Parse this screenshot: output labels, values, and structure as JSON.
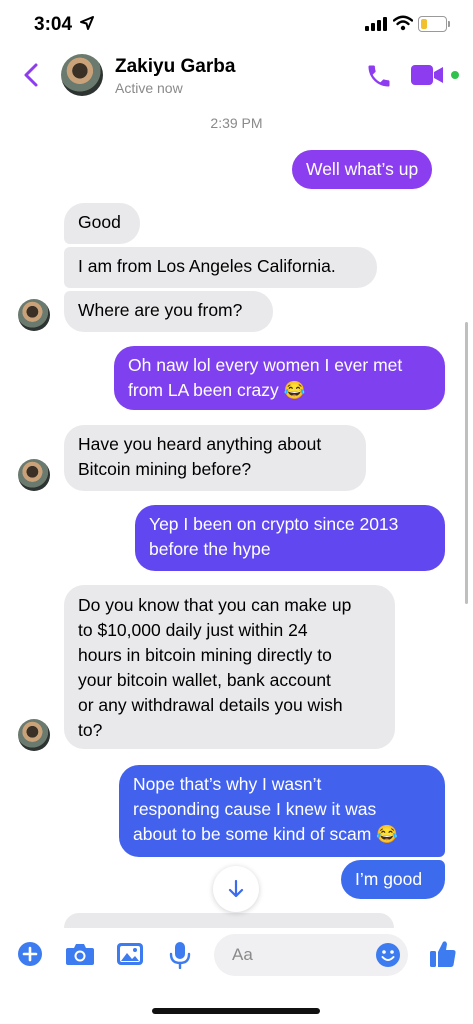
{
  "status_bar": {
    "time": "3:04"
  },
  "header": {
    "contact_name": "Zakiyu Garba",
    "status": "Active now"
  },
  "timestamp": "2:39 PM",
  "messages": [
    {
      "dir": "out",
      "lines": [
        "Well what’s up"
      ]
    },
    {
      "dir": "in",
      "lines": [
        "Good"
      ]
    },
    {
      "dir": "in",
      "lines": [
        "I am from Los Angeles California."
      ]
    },
    {
      "dir": "in",
      "lines": [
        "Where are you from?"
      ]
    },
    {
      "dir": "out",
      "lines": [
        "Oh naw lol every women I ever met",
        "from LA been crazy 😂"
      ]
    },
    {
      "dir": "in",
      "lines": [
        "Have you heard anything about",
        "Bitcoin mining before?"
      ]
    },
    {
      "dir": "out",
      "lines": [
        "Yep I been on crypto since 2013",
        "before the hype"
      ]
    },
    {
      "dir": "in",
      "lines": [
        "Do you know that you can make up",
        "to $10,000 daily just within 24",
        "hours in bitcoin mining directly to",
        "your bitcoin wallet,  bank account",
        "or any withdrawal details you wish",
        "to?"
      ]
    },
    {
      "dir": "out",
      "lines": [
        "Nope that’s why I wasn’t",
        "responding cause I knew it was",
        "about to be some kind of scam 😂"
      ]
    },
    {
      "dir": "out",
      "lines": [
        "I’m good"
      ]
    }
  ],
  "composer": {
    "placeholder": "Aa"
  },
  "colors": {
    "accent": "#8d3cf0",
    "outgoing_top": "#8a3cf0",
    "outgoing_bottom": "#3c6df0",
    "incoming": "#e9e9eb"
  },
  "icons": [
    "back-chevron-icon",
    "phone-icon",
    "video-camera-icon",
    "plus-icon",
    "camera-icon",
    "gallery-icon",
    "microphone-icon",
    "emoji-icon",
    "thumbs-up-icon",
    "scroll-down-arrow-icon"
  ]
}
